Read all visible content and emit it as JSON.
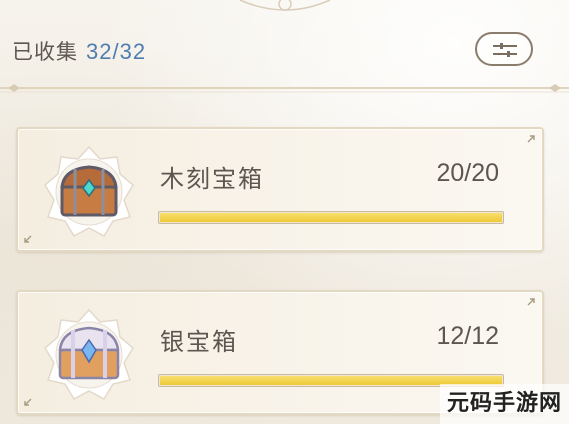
{
  "header": {
    "title": "已收集",
    "count": "32/32"
  },
  "chests": [
    {
      "name": "木刻宝箱",
      "progress_text": "20/20",
      "progress_fraction": 1.0,
      "icon": "wooden-chest-icon"
    },
    {
      "name": "银宝箱",
      "progress_text": "12/12",
      "progress_fraction": 1.0,
      "icon": "silver-chest-icon"
    }
  ],
  "watermark": "元码手游网",
  "colors": {
    "accent_blue": "#4f7db0",
    "bar_fill": "#efc936",
    "card_border": "#e3d8c2",
    "text": "#5d5550"
  }
}
